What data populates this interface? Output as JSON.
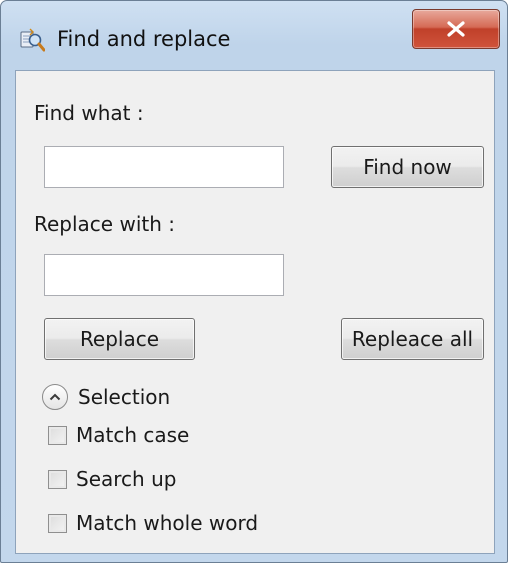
{
  "window": {
    "title": "Find and replace",
    "close_label": "X"
  },
  "find": {
    "label": "Find what :",
    "value": "",
    "button_label": "Find now"
  },
  "replace": {
    "label": "Replace with :",
    "value": "",
    "button_label": "Replace",
    "all_button_label": "Repleace all"
  },
  "selection": {
    "label": "Selection",
    "icon": "chevron-up-icon",
    "expanded": true
  },
  "options": [
    {
      "label": "Match case",
      "checked": false
    },
    {
      "label": "Search up",
      "checked": false
    },
    {
      "label": "Match whole word",
      "checked": false
    }
  ]
}
